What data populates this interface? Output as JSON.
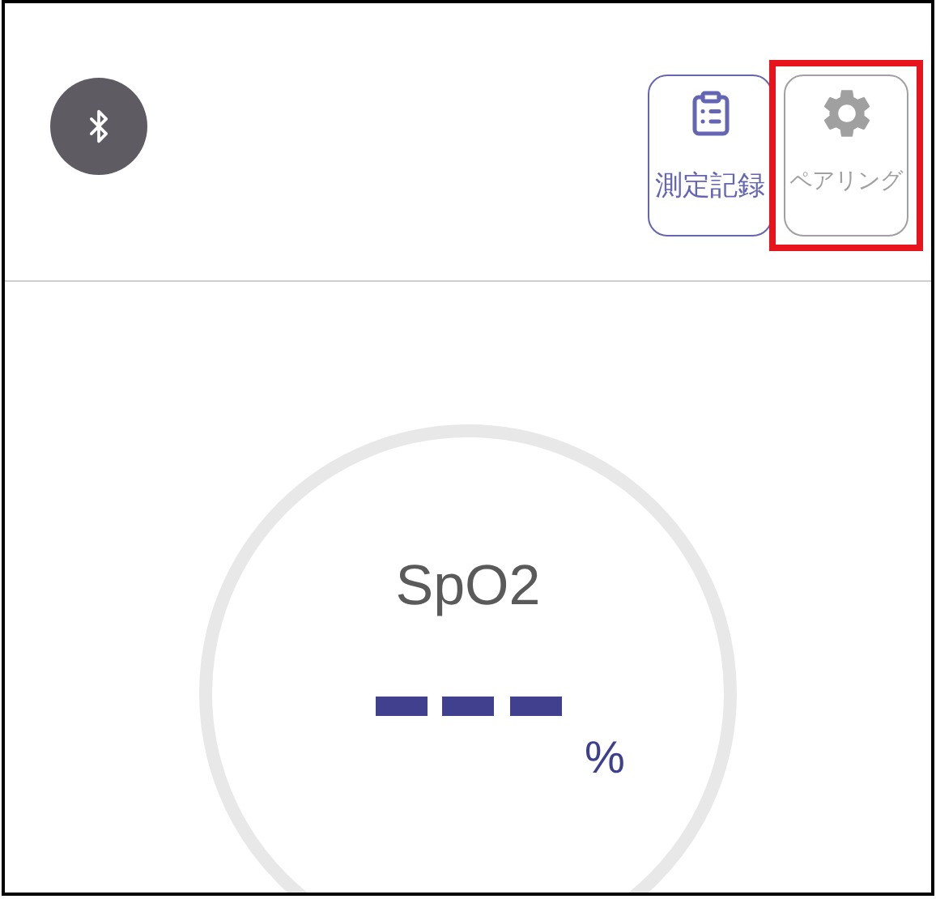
{
  "header": {
    "bluetooth_button": {
      "kind": "bluetooth"
    },
    "buttons": [
      {
        "kind": "records",
        "label": "測定記録",
        "color": "#6565b5",
        "highlighted": false
      },
      {
        "kind": "pairing",
        "label": "ペアリング",
        "color": "#a0a0a0",
        "highlighted": true
      }
    ]
  },
  "reading": {
    "label": "SpO2",
    "has_value": false,
    "unit": "%"
  }
}
